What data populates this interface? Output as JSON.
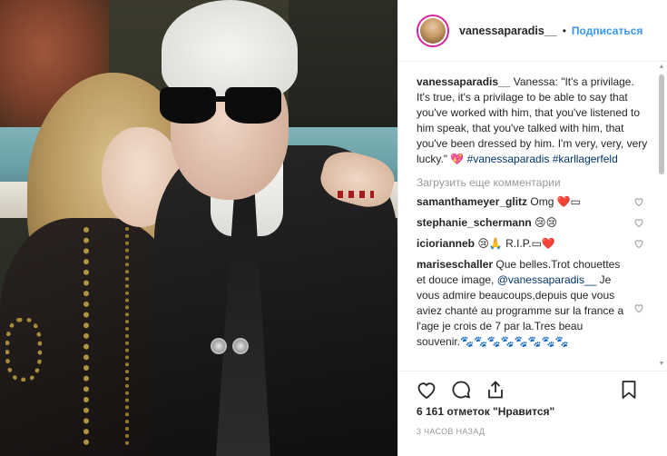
{
  "header": {
    "username": "vanessaparadis__",
    "separator": "•",
    "follow_label": "Подписаться"
  },
  "caption": {
    "username": "vanessaparadis__",
    "text": " Vanessa: \"It's a privilage. It's true, it's a privilage to be able to say that you've worked with him, that you've listened to him speak, that you've talked with him, that you've been dressed by him. I'm very, very, very lucky.\" 💖 ",
    "hashtag1": "#vanessaparadis",
    "hashtag2": "#karllagerfeld"
  },
  "load_more_label": "Загрузить еще комментарии",
  "comments": [
    {
      "username": "samanthameyer_glitz",
      "text": " Omg ❤️▭"
    },
    {
      "username": "stephanie_schermann",
      "text": " 😢😢"
    },
    {
      "username": "iciorianneb",
      "text": " 😢🙏 R.I.P.▭❤️"
    },
    {
      "username": "mariseschaller",
      "text": " Que belles.Trot chouettes et douce image, ",
      "mention": "@vanessaparadis__",
      "text2": " Je vous admire beaucoups,depuis que vous aviez chanté au programme sur la france a l'age je crois de 7 par la.Tres beau souvenir.🐾🐾🐾🐾🐾🐾🐾🐾"
    }
  ],
  "likes_label": "6 161 отметок \"Нравится\"",
  "time_label": "3 ЧАСОВ НАЗАД",
  "icons": {
    "like": "heart-icon",
    "comment": "comment-icon",
    "share": "share-icon",
    "save": "bookmark-icon",
    "comment_like": "small-heart-icon"
  },
  "colors": {
    "link": "#3897f0",
    "hashtag": "#003569",
    "muted": "#999999",
    "text": "#262626"
  }
}
